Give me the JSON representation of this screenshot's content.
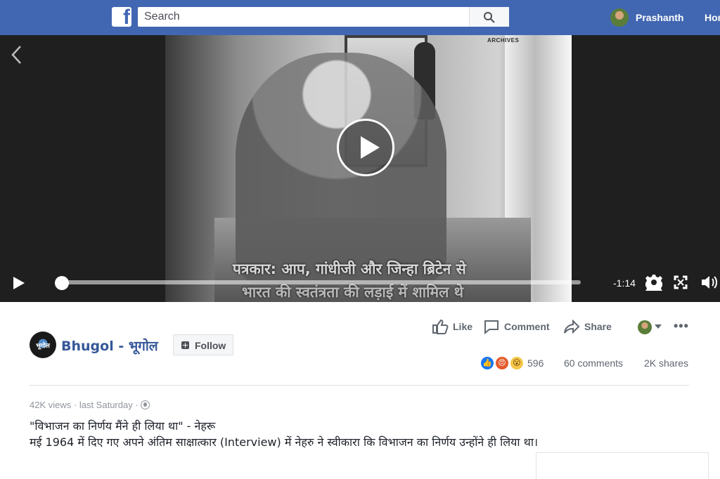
{
  "header": {
    "logo": "f",
    "search_placeholder": "Search",
    "profile_name": "Prashanth",
    "home_link": "Hom",
    "colors": {
      "bar": "#4267b2",
      "text": "#ffffff"
    }
  },
  "video": {
    "archive_text": "ARCHIVES",
    "subtitle_line1": "पत्रकार: आप, गांधीजी और जिन्हा ब्रिटेन से",
    "subtitle_line2": "भारत की स्वतंत्रता की लड़ाई में शामिल थे",
    "progress_fraction": 0.01,
    "time_remaining": "-1:14",
    "icons": [
      "back-chevron-icon",
      "play-icon",
      "gear-icon",
      "fullscreen-icon",
      "volume-icon"
    ]
  },
  "post": {
    "page_logo_text": "भूगोल",
    "page_name": "Bhugol - भूगोल",
    "follow_label": "Follow",
    "actions": {
      "like": "Like",
      "comment": "Comment",
      "share": "Share",
      "more": "•••"
    },
    "reactions": {
      "count": "596",
      "comments": "60 comments",
      "shares": "2K shares",
      "icons": [
        "like-icon",
        "angry-icon",
        "wow-icon"
      ]
    },
    "views": "42K views",
    "separator": "·",
    "posted": "last Saturday",
    "description_line1": "\"विभाजन का निर्णय मैंने ही लिया था\" - नेहरू",
    "description_line2": "मई 1964 में दिए गए अपने अंतिम साक्षात्कार (Interview) में नेहरु ने स्वीकारा कि विभाजन का निर्णय उन्होंने ही लिया था।"
  }
}
